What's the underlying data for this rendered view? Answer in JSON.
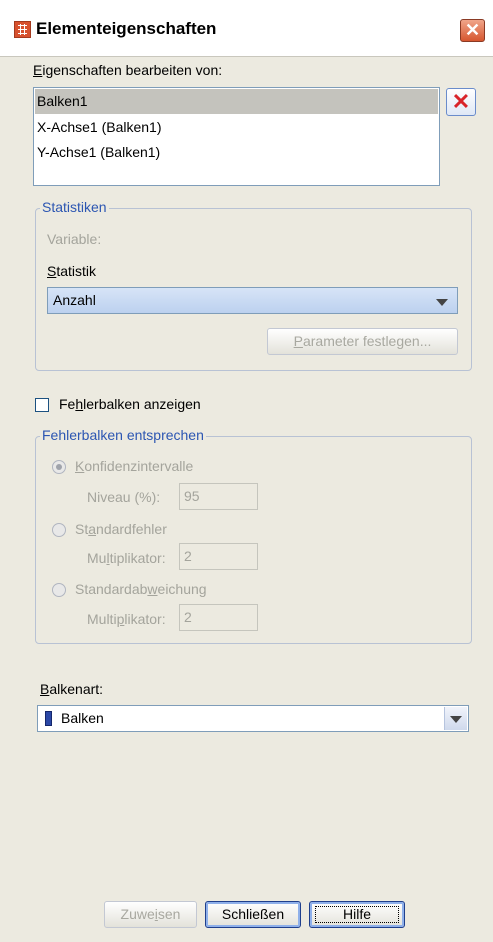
{
  "window": {
    "title": "Elementeigenschaften",
    "close_glyph": "✕"
  },
  "edit_props": {
    "label_prefix": "E",
    "label_rest": "igenschaften bearbeiten von:",
    "items": [
      "Balken1",
      "X-Achse1 (Balken1)",
      "Y-Achse1 (Balken1)"
    ],
    "selected_index": 0
  },
  "delete_icon": "✕",
  "statistics": {
    "group_title": "Statistiken",
    "variable_label": "Variable:",
    "statistic_label_ul": "S",
    "statistic_label_rest": "tatistik",
    "statistic_value": "Anzahl",
    "params_button_ul": "P",
    "params_button_rest": "arameter festlegen..."
  },
  "errorbars": {
    "checkbox_pre": "Fe",
    "checkbox_ul": "h",
    "checkbox_rest": "lerbalken anzeigen",
    "checked": false,
    "group_title": "Fehlerbalken entsprechen",
    "options": [
      {
        "pre": "",
        "ul": "K",
        "rest": "onfidenzintervalle",
        "field_label": "Niveau (%):",
        "field_value": "95",
        "checked": true
      },
      {
        "pre": "St",
        "ul": "a",
        "rest": "ndardfehler",
        "field_label_pre": "Mu",
        "field_label_ul": "l",
        "field_label_rest": "tiplikator:",
        "field_value": "2",
        "checked": false
      },
      {
        "pre": "Standardab",
        "ul": "w",
        "rest": "eichung",
        "field_label_pre": "Multi",
        "field_label_ul": "p",
        "field_label_rest": "likator:",
        "field_value": "2",
        "checked": false
      }
    ]
  },
  "bar_type": {
    "label_ul": "B",
    "label_rest": "alkenart:",
    "value": "Balken"
  },
  "buttons": {
    "apply_pre": "Zuwe",
    "apply_ul": "i",
    "apply_rest": "sen",
    "close": "Schließen",
    "help": "Hilfe"
  },
  "colors": {
    "accent": "#2c56b2",
    "background": "#eceae0",
    "bar_icon": "#2b48a6"
  }
}
